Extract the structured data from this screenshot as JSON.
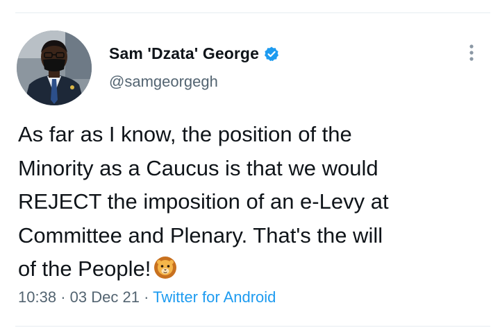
{
  "tweet": {
    "author": {
      "display_name": "Sam 'Dzata' George",
      "handle": "@samgeorgegh",
      "verified": true,
      "avatar_icon": "profile-photo-man-in-suit-wearing-face-mask"
    },
    "text": "As far as I know, the position of the\nMinority as a Caucus is that we would\nREJECT the imposition of an e-Levy at\nCommittee and Plenary. That's the will\nof the People!",
    "emoji": "lion-face-icon",
    "time": "10:38",
    "separator": "·",
    "date": "03 Dec 21",
    "source": "Twitter for Android",
    "more_options_icon": "more-vertical-icon"
  },
  "colors": {
    "text_primary": "#0f1419",
    "text_secondary": "#536471",
    "accent": "#1d9bf0",
    "divider": "#e6ecf0"
  }
}
